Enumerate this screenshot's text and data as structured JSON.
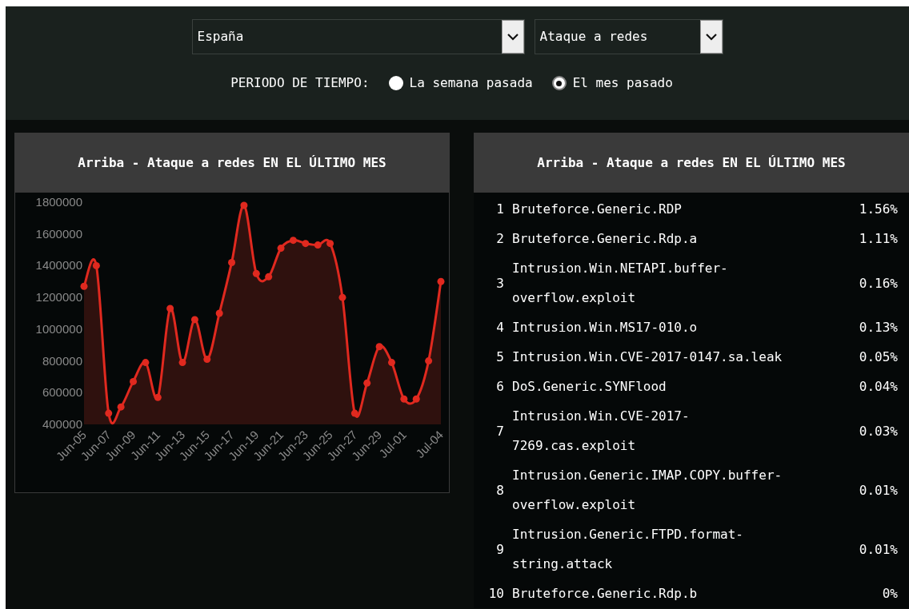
{
  "filters": {
    "country": "España",
    "category": "Ataque a redes"
  },
  "period": {
    "label": "PERIODO DE TIEMPO:",
    "options": [
      {
        "label": "La semana pasada",
        "selected": false
      },
      {
        "label": "El mes pasado",
        "selected": true
      }
    ]
  },
  "chart_panel": {
    "title": "Arriba - Ataque a redes EN EL ÚLTIMO MES",
    "chart_data": {
      "type": "area",
      "categories": [
        "Jun-05",
        null,
        "Jun-07",
        null,
        "Jun-09",
        null,
        "Jun-11",
        null,
        "Jun-13",
        null,
        "Jun-15",
        null,
        "Jun-17",
        null,
        "Jun-19",
        null,
        "Jun-21",
        null,
        "Jun-23",
        null,
        "Jun-25",
        null,
        "Jun-27",
        null,
        "Jun-29",
        null,
        "Jul-01",
        null,
        null,
        "Jul-04"
      ],
      "series": [
        {
          "color": "#e0291f",
          "values": [
            1270000,
            1400000,
            470000,
            510000,
            670000,
            790000,
            570000,
            1130000,
            790000,
            1060000,
            810000,
            1100000,
            1420000,
            1780000,
            1350000,
            1330000,
            1510000,
            1560000,
            1540000,
            1530000,
            1540000,
            1200000,
            470000,
            660000,
            890000,
            790000,
            560000,
            560000,
            800000,
            1300000
          ]
        }
      ],
      "ylim": [
        400000,
        1800000
      ],
      "yticks": [
        400000,
        600000,
        800000,
        1000000,
        1200000,
        1400000,
        1600000,
        1800000
      ]
    }
  },
  "table_panel": {
    "title": "Arriba - Ataque a redes EN EL ÚLTIMO MES",
    "rows": [
      {
        "rank": "1",
        "name": "Bruteforce.Generic.RDP",
        "share": "1.56%"
      },
      {
        "rank": "2",
        "name": "Bruteforce.Generic.Rdp.a",
        "share": "1.11%"
      },
      {
        "rank": "3",
        "name": "Intrusion.Win.NETAPI.buffer-overflow.exploit",
        "share": "0.16%"
      },
      {
        "rank": "4",
        "name": "Intrusion.Win.MS17-010.o",
        "share": "0.13%"
      },
      {
        "rank": "5",
        "name": "Intrusion.Win.CVE-2017-0147.sa.leak",
        "share": "0.05%"
      },
      {
        "rank": "6",
        "name": "DoS.Generic.SYNFlood",
        "share": "0.04%"
      },
      {
        "rank": "7",
        "name": "Intrusion.Win.CVE-2017-7269.cas.exploit",
        "share": "0.03%"
      },
      {
        "rank": "8",
        "name": "Intrusion.Generic.IMAP.COPY.buffer-overflow.exploit",
        "share": "0.01%"
      },
      {
        "rank": "9",
        "name": "Intrusion.Generic.FTPD.format-string.attack",
        "share": "0.01%"
      },
      {
        "rank": "10",
        "name": "Bruteforce.Generic.Rdp.b",
        "share": "0%"
      }
    ]
  }
}
